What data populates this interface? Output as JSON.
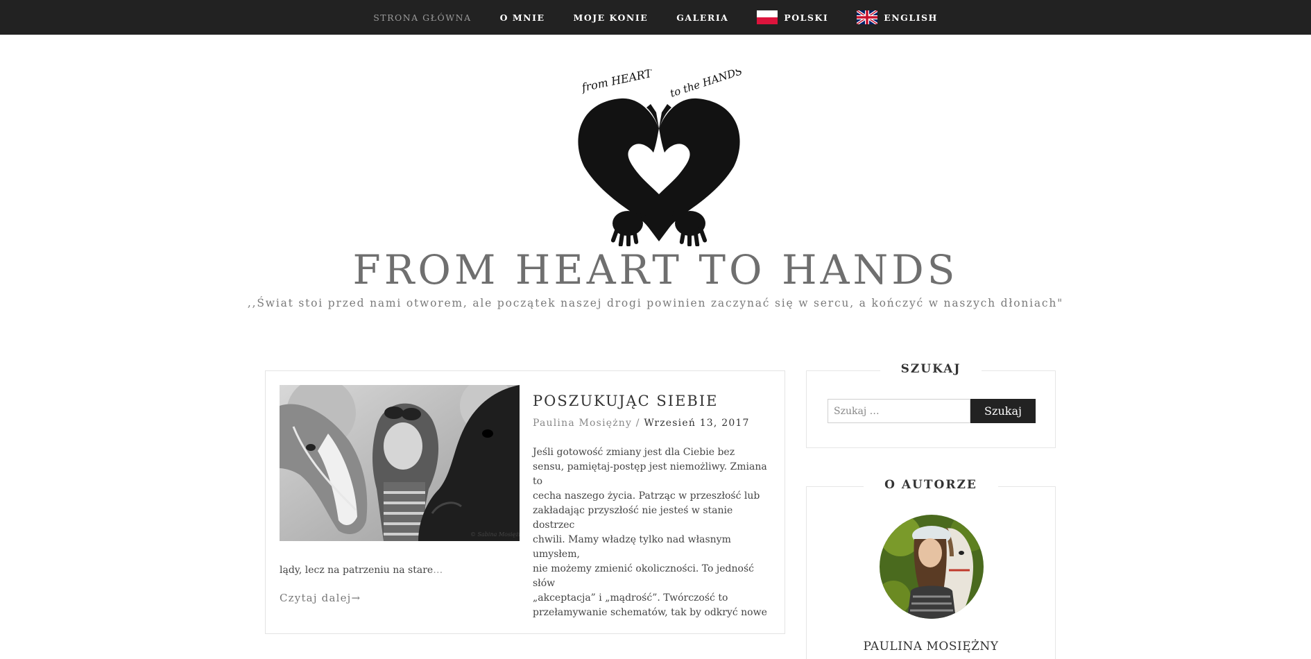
{
  "nav": {
    "items": [
      {
        "label": "STRONA GŁÓWNA",
        "active": true
      },
      {
        "label": "O MNIE"
      },
      {
        "label": "MOJE KONIE"
      },
      {
        "label": "GALERIA"
      },
      {
        "label": "POLSKI",
        "icon": "poland-flag-icon"
      },
      {
        "label": "ENGLISH",
        "icon": "uk-flag-icon"
      }
    ]
  },
  "header": {
    "logo_text_left": "from HEART",
    "logo_text_right": "to the HANDS",
    "title": "FROM HEART TO HANDS",
    "tagline": ",,Świat stoi przed nami otworem, ale początek naszej drogi powinien zaczynać się w sercu, a kończyć w naszych dłoniach\""
  },
  "post": {
    "title": "POSZUKUJĄC SIEBIE",
    "author": "Paulina Mosiężny",
    "separator": "/",
    "date": "Wrzesień 13, 2017",
    "excerpt_lines": [
      "Jeśli gotowość zmiany jest dla Ciebie bez",
      "sensu, pamiętaj-postęp jest niemożliwy. Zmiana to",
      "cecha naszego życia. Patrząc w przeszłość lub",
      "zakładając przyszłość nie jesteś w stanie dostrzec",
      "chwili. Mamy władzę tylko nad własnym umysłem,",
      "nie możemy zmienić okoliczności. To jedność słów",
      "„akceptacja” i „mądrość”. Twórczość to",
      "przełamywanie schematów, tak by odkryć nowe"
    ],
    "excerpt_tail": "lądy, lecz na patrzeniu na stare",
    "excerpt_ellipsis": "…",
    "read_more": "Czytaj dalej→"
  },
  "sidebar": {
    "search": {
      "title": "SZUKAJ",
      "placeholder": "Szukaj …",
      "button": "Szukaj"
    },
    "author": {
      "title": "O AUTORZE",
      "name": "PAULINA MOSIĘŻNY"
    }
  },
  "colors": {
    "nav_bg": "#222222",
    "title_gray": "#6f6f6f",
    "border": "#e3e3e3"
  }
}
